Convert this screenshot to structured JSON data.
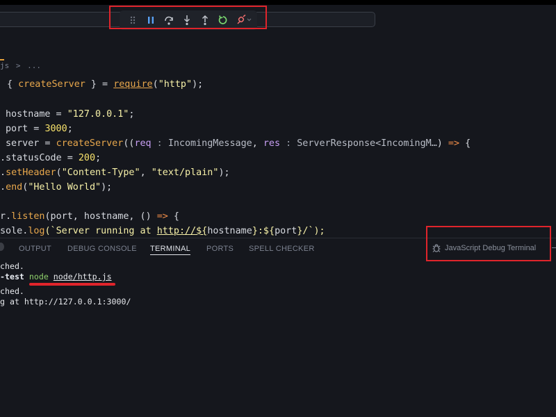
{
  "breadcrumb": {
    "file": "js",
    "separator": ">",
    "rest": "..."
  },
  "debug_toolbar": {
    "buttons": [
      {
        "name": "drag-handle",
        "icon": "grip-icon"
      },
      {
        "name": "pause",
        "icon": "pause-icon"
      },
      {
        "name": "step-over",
        "icon": "step-over-icon"
      },
      {
        "name": "step-into",
        "icon": "step-into-icon"
      },
      {
        "name": "step-out",
        "icon": "step-out-icon"
      },
      {
        "name": "restart",
        "icon": "restart-icon"
      },
      {
        "name": "disconnect",
        "icon": "disconnect-icon"
      }
    ],
    "colors": {
      "pause": "#5aa2f5",
      "step": "#c0c4cc",
      "restart": "#7bd870",
      "disconnect": "#f36f6f"
    }
  },
  "code": {
    "l1": {
      "a": "{ ",
      "b": "createServer",
      "c": " } = ",
      "d": "require",
      "e": "(",
      "f": "\"http\"",
      "g": ");"
    },
    "l2": {
      "a": "hostname = ",
      "b": "\"127.0.0.1\"",
      "c": ";"
    },
    "l3": {
      "a": "port = ",
      "b": "3000",
      "c": ";"
    },
    "l4": {
      "a": "server = ",
      "b": "createServer",
      "c": "((",
      "d": "req",
      "e": " : ",
      "f": "IncomingMessage",
      "g": ", ",
      "h": "res",
      "i": " : ",
      "j": "ServerResponse<IncomingM…",
      "k": ") ",
      "l": "=>",
      "m": " {"
    },
    "l5": {
      "a": ".statusCode = ",
      "b": "200",
      "c": ";"
    },
    "l6": {
      "a": ".",
      "b": "setHeader",
      "c": "(",
      "d": "\"Content-Type\"",
      "e": ", ",
      "f": "\"text/plain\"",
      "g": ");"
    },
    "l7": {
      "a": ".",
      "b": "end",
      "c": "(",
      "d": "\"Hello World\"",
      "e": ");"
    },
    "l8": {
      "a": "r.",
      "b": "listen",
      "c": "(port, hostname, () ",
      "d": "=>",
      "e": " {"
    },
    "l9": {
      "a": "sole.",
      "b": "log",
      "c": "(`Server running at ",
      "d": "http://${",
      "e": "hostname",
      "f": "}:${",
      "g": "port",
      "h": "}/",
      "i": "`);"
    }
  },
  "panel": {
    "tabs": [
      "OUTPUT",
      "DEBUG CONSOLE",
      "TERMINAL",
      "PORTS",
      "SPELL CHECKER"
    ],
    "active_tab": "TERMINAL",
    "debug_terminal_label": "JavaScript Debug Terminal"
  },
  "terminal": {
    "line1": "ched.",
    "line2_prompt": "-test",
    "line2_cmd": "node",
    "line2_arg": "node/http.js",
    "line3": "ched.",
    "line4": "g at http://127.0.0.1:3000/"
  }
}
